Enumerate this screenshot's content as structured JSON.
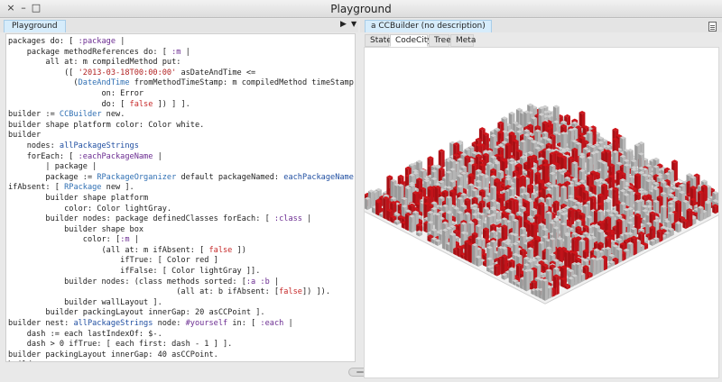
{
  "window": {
    "title": "Playground",
    "close_glyph": "×",
    "minimize_glyph": "–",
    "maximize_glyph": "□"
  },
  "left_pane": {
    "tab_label": "Playground",
    "play_glyph": "▶",
    "dropdown_glyph": "▼",
    "code_lines": [
      [
        {
          "t": "packages do: [ ",
          "c": ""
        },
        {
          "t": ":package",
          "c": "sym"
        },
        {
          "t": " |",
          "c": ""
        }
      ],
      [
        {
          "t": "    package methodReferences do: [ ",
          "c": ""
        },
        {
          "t": ":m",
          "c": "sym"
        },
        {
          "t": " |",
          "c": ""
        }
      ],
      [
        {
          "t": "        all at: m compiledMethod put:",
          "c": ""
        }
      ],
      [
        {
          "t": "            ([ ",
          "c": ""
        },
        {
          "t": "'2013-03-18T00:00:00'",
          "c": "str"
        },
        {
          "t": " asDateAndTime <=",
          "c": ""
        }
      ],
      [
        {
          "t": "              (",
          "c": ""
        },
        {
          "t": "DateAndTime",
          "c": "cls"
        },
        {
          "t": " fromMethodTimeStamp: m compiledMethod timeStamp) ]",
          "c": ""
        }
      ],
      [
        {
          "t": "                    on: Error",
          "c": ""
        }
      ],
      [
        {
          "t": "                    do: [ ",
          "c": ""
        },
        {
          "t": "false",
          "c": "blk"
        },
        {
          "t": " ]) ] ].",
          "c": ""
        }
      ],
      [
        {
          "t": "builder := ",
          "c": ""
        },
        {
          "t": "CCBuilder",
          "c": "cls"
        },
        {
          "t": " new.",
          "c": ""
        }
      ],
      [
        {
          "t": "builder shape platform color: Color white.",
          "c": ""
        }
      ],
      [
        {
          "t": "builder",
          "c": ""
        }
      ],
      [
        {
          "t": "    nodes: ",
          "c": ""
        },
        {
          "t": "allPackageStrings",
          "c": "kw"
        }
      ],
      [
        {
          "t": "    forEach: [ ",
          "c": ""
        },
        {
          "t": ":eachPackageName",
          "c": "sym"
        },
        {
          "t": " |",
          "c": ""
        }
      ],
      [
        {
          "t": "        | package |",
          "c": ""
        }
      ],
      [
        {
          "t": "        package := ",
          "c": ""
        },
        {
          "t": "RPackageOrganizer",
          "c": "cls"
        },
        {
          "t": " default packageNamed: ",
          "c": ""
        },
        {
          "t": "eachPackageName",
          "c": "kw"
        }
      ],
      [
        {
          "t": "ifAbsent: [ ",
          "c": ""
        },
        {
          "t": "RPackage",
          "c": "cls"
        },
        {
          "t": " new ].",
          "c": ""
        }
      ],
      [
        {
          "t": "        builder shape platform",
          "c": ""
        }
      ],
      [
        {
          "t": "            color: Color lightGray.",
          "c": ""
        }
      ],
      [
        {
          "t": "        builder nodes: package definedClasses forEach: [ ",
          "c": ""
        },
        {
          "t": ":class",
          "c": "sym"
        },
        {
          "t": " |",
          "c": ""
        }
      ],
      [
        {
          "t": "            builder shape box",
          "c": ""
        }
      ],
      [
        {
          "t": "                color: [",
          "c": ""
        },
        {
          "t": ":m",
          "c": "sym"
        },
        {
          "t": " |",
          "c": ""
        }
      ],
      [
        {
          "t": "                    (all at: m ifAbsent: [ ",
          "c": ""
        },
        {
          "t": "false",
          "c": "blk"
        },
        {
          "t": " ])",
          "c": ""
        }
      ],
      [
        {
          "t": "                        ifTrue: [ Color red ]",
          "c": ""
        }
      ],
      [
        {
          "t": "                        ifFalse: [ Color lightGray ]].",
          "c": ""
        }
      ],
      [
        {
          "t": "            builder nodes: (class methods sorted: [",
          "c": ""
        },
        {
          "t": ":a :b",
          "c": "sym"
        },
        {
          "t": " |",
          "c": ""
        }
      ],
      [
        {
          "t": "                                    (all at: b ifAbsent: [",
          "c": ""
        },
        {
          "t": "false",
          "c": "blk"
        },
        {
          "t": "]) ]).",
          "c": ""
        }
      ],
      [
        {
          "t": "            builder wallLayout ].",
          "c": ""
        }
      ],
      [
        {
          "t": "        builder packingLayout innerGap: 20 asCCPoint ].",
          "c": ""
        }
      ],
      [
        {
          "t": "builder nest: ",
          "c": ""
        },
        {
          "t": "allPackageStrings",
          "c": "kw"
        },
        {
          "t": " node: ",
          "c": ""
        },
        {
          "t": "#yourself",
          "c": "sym"
        },
        {
          "t": " in: [ ",
          "c": ""
        },
        {
          "t": ":each",
          "c": "sym"
        },
        {
          "t": " |",
          "c": ""
        }
      ],
      [
        {
          "t": "    dash := each lastIndexOf: $-.",
          "c": ""
        }
      ],
      [
        {
          "t": "    dash > 0 ifTrue: [ each first: dash - 1 ] ].",
          "c": ""
        }
      ],
      [
        {
          "t": "builder packingLayout innerGap: 40 asCCPoint.",
          "c": ""
        }
      ],
      [
        {
          "t": "builder",
          "c": ""
        }
      ]
    ]
  },
  "right_pane": {
    "tab_label": "a CCBuilder (no description)",
    "subtabs": [
      "State",
      "CodeCity",
      "Tree",
      "Meta"
    ],
    "active_subtab": "CodeCity",
    "city_colors": {
      "ground": "#f1f1f1",
      "building": "#9a9a9a",
      "building_light": "#d0d0d0",
      "highlight": "#d0141a"
    }
  }
}
